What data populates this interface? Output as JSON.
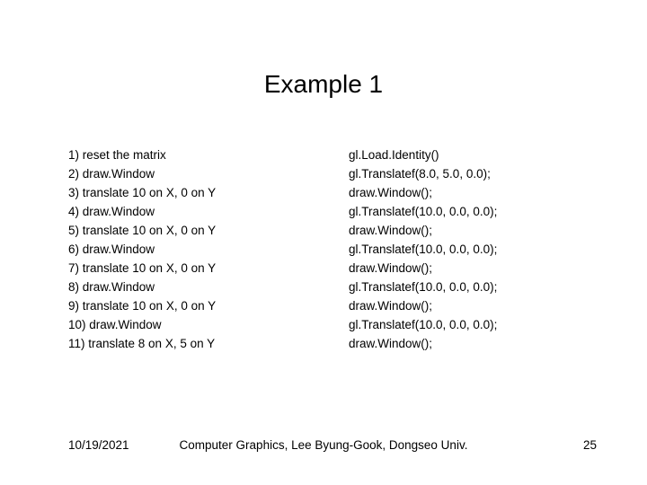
{
  "title": "Example 1",
  "left_col": [
    "1) reset the matrix",
    "2) draw.Window",
    "3) translate 10 on X, 0 on Y",
    "4) draw.Window",
    "5) translate 10 on X, 0 on Y",
    "6) draw.Window",
    "7) translate 10 on X, 0 on Y",
    "8) draw.Window",
    "9) translate 10 on X, 0 on Y",
    "10) draw.Window",
    "11) translate 8 on X, 5 on Y"
  ],
  "right_col": [
    "gl.Load.Identity()",
    "gl.Translatef(8.0, 5.0, 0.0);",
    "draw.Window();",
    "gl.Translatef(10.0, 0.0, 0.0);",
    "draw.Window();",
    "gl.Translatef(10.0, 0.0, 0.0);",
    "draw.Window();",
    "gl.Translatef(10.0, 0.0, 0.0);",
    "draw.Window();",
    "gl.Translatef(10.0, 0.0, 0.0);",
    "draw.Window();"
  ],
  "footer": {
    "date": "10/19/2021",
    "center": "Computer Graphics, Lee Byung-Gook, Dongseo Univ.",
    "page": "25"
  }
}
